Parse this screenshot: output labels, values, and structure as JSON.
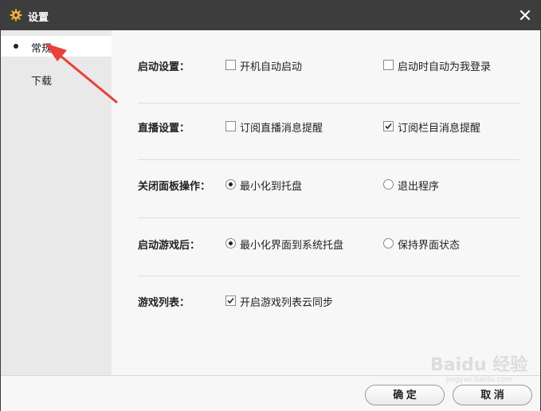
{
  "window": {
    "title": "设置",
    "icon": "gear-icon",
    "close_icon": "close-icon"
  },
  "sidebar": {
    "items": [
      {
        "label": "常规",
        "active": true
      },
      {
        "label": "下载",
        "active": false
      }
    ]
  },
  "settings": {
    "startup": {
      "label": "启动设置：",
      "options": [
        {
          "type": "checkbox",
          "label": "开机自动启动",
          "checked": false
        },
        {
          "type": "checkbox",
          "label": "启动时自动为我登录",
          "checked": false
        }
      ]
    },
    "live": {
      "label": "直播设置：",
      "options": [
        {
          "type": "checkbox",
          "label": "订阅直播消息提醒",
          "checked": false
        },
        {
          "type": "checkbox",
          "label": "订阅栏目消息提醒",
          "checked": true
        }
      ]
    },
    "close_panel": {
      "label": "关闭面板操作：",
      "options": [
        {
          "type": "radio",
          "label": "最小化到托盘",
          "checked": true
        },
        {
          "type": "radio",
          "label": "退出程序",
          "checked": false
        }
      ]
    },
    "after_game": {
      "label": "启动游戏后：",
      "options": [
        {
          "type": "radio",
          "label": "最小化界面到系统托盘",
          "checked": true
        },
        {
          "type": "radio",
          "label": "保持界面状态",
          "checked": false
        }
      ]
    },
    "game_list": {
      "label": "游戏列表：",
      "options": [
        {
          "type": "checkbox",
          "label": "开启游戏列表云同步",
          "checked": true
        }
      ]
    }
  },
  "footer": {
    "ok_label": "确 定",
    "cancel_label": "取 消"
  },
  "annotation": {
    "arrow_color": "#e8403a"
  },
  "watermark": {
    "text": "Baidu 经验",
    "sub": "jingyan.baidu.com"
  },
  "colors": {
    "titlebar": "#3d3d3d",
    "gear": "#f2b233",
    "sidebar": "#e9e9e9",
    "content": "#f7f7f7"
  }
}
